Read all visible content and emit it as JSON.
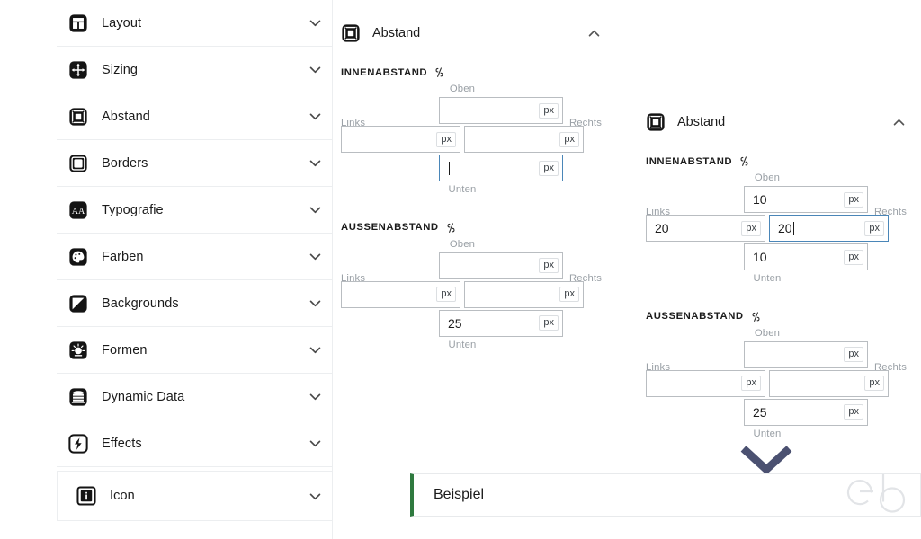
{
  "sidebar": {
    "items": [
      {
        "label": "Layout",
        "icon": "layout-icon",
        "chevron": "chevron-down"
      },
      {
        "label": "Sizing",
        "icon": "sizing-icon",
        "chevron": "chevron-down"
      },
      {
        "label": "Abstand",
        "icon": "spacing-icon",
        "chevron": "chevron-down"
      },
      {
        "label": "Borders",
        "icon": "borders-icon",
        "chevron": "chevron-down"
      },
      {
        "label": "Typografie",
        "icon": "typography-icon",
        "chevron": "chevron-down"
      },
      {
        "label": "Farben",
        "icon": "palette-icon",
        "chevron": "chevron-down"
      },
      {
        "label": "Backgrounds",
        "icon": "backgrounds-icon",
        "chevron": "chevron-down"
      },
      {
        "label": "Formen",
        "icon": "shapes-icon",
        "chevron": "chevron-down"
      },
      {
        "label": "Dynamic Data",
        "icon": "database-icon",
        "chevron": "chevron-down"
      },
      {
        "label": "Effects",
        "icon": "effects-icon",
        "chevron": "chevron-down"
      },
      {
        "label": "Icon",
        "icon": "info-icon",
        "chevron": "chevron-down"
      }
    ]
  },
  "middle_panel": {
    "title": "Abstand",
    "icon": "spacing-icon",
    "collapse_chevron": "chevron-up",
    "padding": {
      "section_label": "INNENABSTAND",
      "link_icon": "code-link-icon",
      "top_label": "Oben",
      "left_label": "Links",
      "right_label": "Rechts",
      "bottom_label": "Unten",
      "unit": "px",
      "top_value": "",
      "left_value": "",
      "right_value": "",
      "bottom_value": "",
      "focused_field": "bottom"
    },
    "margin": {
      "section_label": "AUSSENABSTAND",
      "link_icon": "code-link-icon",
      "top_label": "Oben",
      "left_label": "Links",
      "right_label": "Rechts",
      "bottom_label": "Unten",
      "unit": "px",
      "top_value": "",
      "left_value": "",
      "right_value": "",
      "bottom_value": "25",
      "focused_field": ""
    }
  },
  "right_panel": {
    "title": "Abstand",
    "icon": "spacing-icon",
    "collapse_chevron": "chevron-up",
    "padding": {
      "section_label": "INNENABSTAND",
      "link_icon": "code-link-icon",
      "top_label": "Oben",
      "left_label": "Links",
      "right_label": "Rechts",
      "bottom_label": "Unten",
      "unit": "px",
      "top_value": "10",
      "left_value": "20",
      "right_value": "20",
      "bottom_value": "10",
      "focused_field": "right"
    },
    "margin": {
      "section_label": "AUSSENABSTAND",
      "link_icon": "code-link-icon",
      "top_label": "Oben",
      "left_label": "Links",
      "right_label": "Rechts",
      "bottom_label": "Unten",
      "unit": "px",
      "top_value": "",
      "left_value": "",
      "right_value": "",
      "bottom_value": "25",
      "focused_field": ""
    }
  },
  "pointer": {
    "icon": "chevron-down-large",
    "color": "#4b5171"
  },
  "example": {
    "text": "Beispiel",
    "accent_color": "#2f7a3f",
    "watermark": "eb"
  },
  "colors": {
    "focus_border": "#4a86b8",
    "field_border": "#b9bdc1",
    "divider": "#eceef0",
    "muted_text": "#9aa0a6",
    "text": "#1b1b1b"
  }
}
